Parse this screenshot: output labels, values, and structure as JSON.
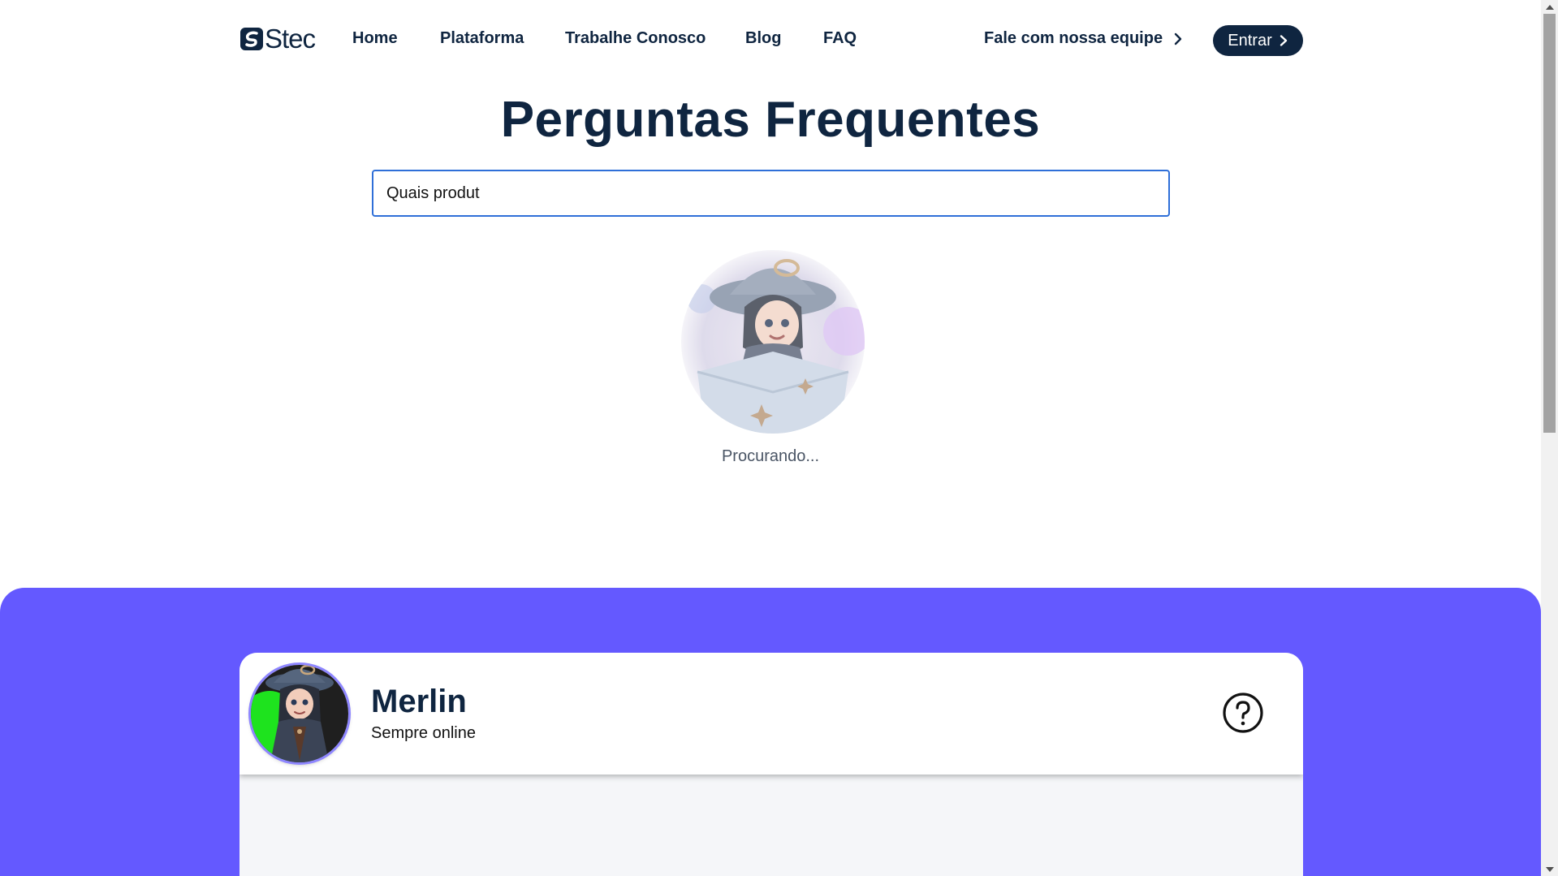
{
  "nav": {
    "logo_text": "Stec",
    "links": [
      "Home",
      "Plataforma",
      "Trabalhe Conosco",
      "Blog",
      "FAQ"
    ],
    "contact_label": "Fale com nossa equipe",
    "login_label": "Entrar"
  },
  "faq": {
    "title": "Perguntas Frequentes",
    "search_value": "Quais produt",
    "status_text": "Procurando..."
  },
  "chat": {
    "bot_name": "Merlin",
    "bot_status": "Sempre online"
  },
  "colors": {
    "brand_navy": "#0f2540",
    "accent_purple": "#6459ff",
    "input_focus_blue": "#2f6fd8"
  },
  "icons": [
    "logo-icon",
    "chevron-right-icon",
    "help-circle-icon",
    "wizard-avatar"
  ]
}
